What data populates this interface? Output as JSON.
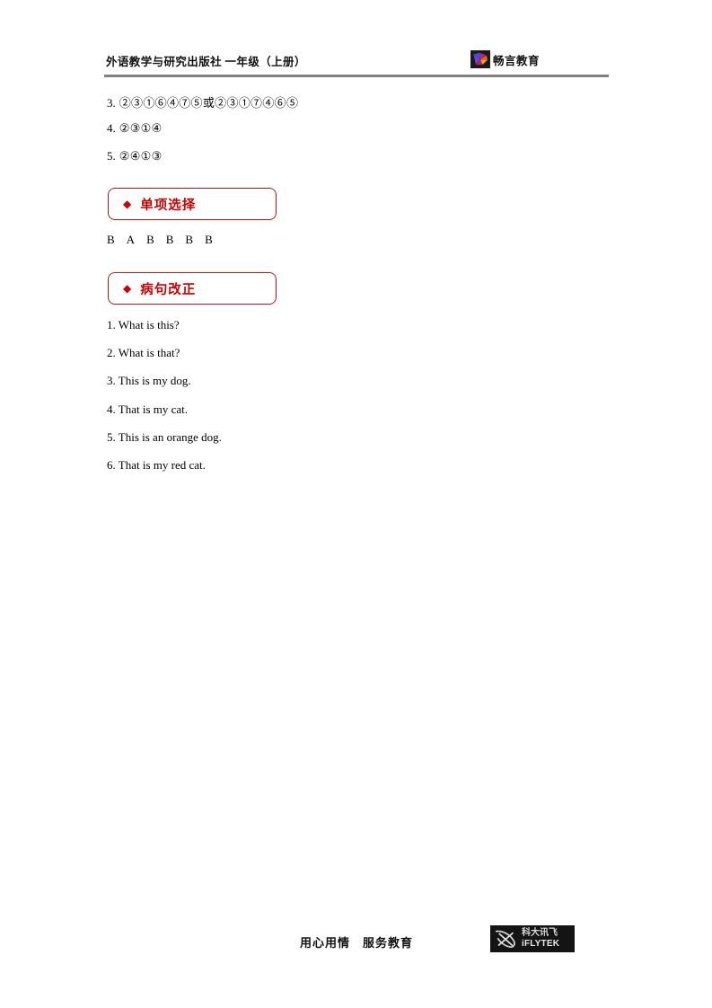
{
  "header": {
    "title": "外语教学与研究出版社  一年级（上册）",
    "brand_name": "畅言教育",
    "brand_logo_icon": "chang-yan-bird-logo-icon",
    "rule_color": "#808080"
  },
  "answers_ordering": {
    "items": [
      {
        "num": "3.",
        "circles": "②③①⑥④⑦⑤或②③①⑦④⑥⑤"
      },
      {
        "num": "4.",
        "circles": "②③①④"
      },
      {
        "num": "5.",
        "circles": "②④①③"
      }
    ]
  },
  "sections": [
    {
      "bullet": "◆",
      "label": "单项选择",
      "accent_color": "#cc0000",
      "border_color": "#b01a17"
    },
    {
      "bullet": "◆",
      "label": "病句改正",
      "accent_color": "#cc0000",
      "border_color": "#b01a17"
    }
  ],
  "multiple_choice": {
    "answers": [
      "B",
      "A",
      "B",
      "B",
      "B",
      "B"
    ]
  },
  "sentence_correction": {
    "sentences": [
      "1. What is this?",
      "2. What is that?",
      "3. This is my dog.",
      "4. That is my cat.",
      "5. This is an orange dog.",
      "6. That is my red cat."
    ]
  },
  "footer": {
    "slogan": "用心用情　服务教育",
    "logo_icon": "iflytek-logo-icon",
    "logo_cn": "科大讯飞",
    "logo_en": "iFLYTEK",
    "logo_background": "#141414"
  }
}
